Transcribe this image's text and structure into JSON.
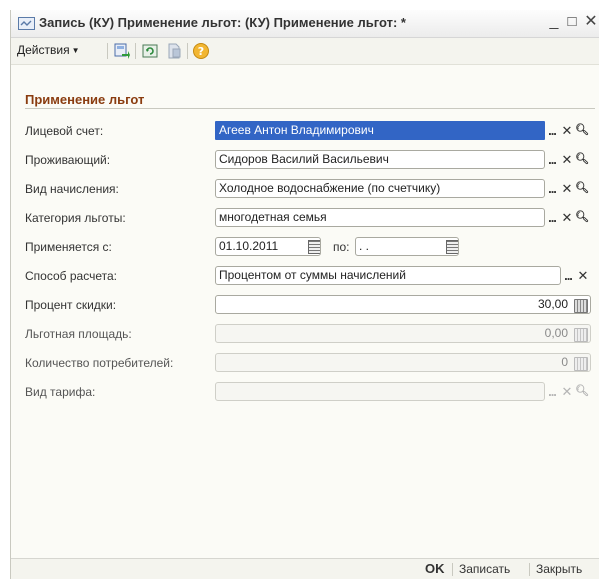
{
  "window": {
    "title": "Запись (КУ) Применение льгот: (КУ) Применение льгот: *",
    "minimize": "_",
    "maximize": "□",
    "close": "✕"
  },
  "toolbar": {
    "actions_label": "Действия",
    "icons": [
      "save-close-icon",
      "refresh-icon",
      "document-icon",
      "help-icon"
    ]
  },
  "section": {
    "title": "Применение льгот"
  },
  "form": {
    "account": {
      "label": "Лицевой счет:",
      "value": "Агеев Антон Владимирович"
    },
    "resident": {
      "label": "Проживающий:",
      "value": "Сидоров Василий Васильевич"
    },
    "charge_type": {
      "label": "Вид начисления:",
      "value": "Холодное водоснабжение  (по счетчику)"
    },
    "benefit_category": {
      "label": "Категория льготы:",
      "value": "многодетная семья"
    },
    "applies_from": {
      "label": "Применяется с:",
      "value": "01.10.2011",
      "to_label": "по:",
      "to_value": " .  ."
    },
    "calc_method": {
      "label": "Способ расчета:",
      "value": "Процентом от суммы начислений"
    },
    "discount_percent": {
      "label": "Процент скидки:",
      "value": "30,00"
    },
    "benefit_area": {
      "label": "Льготная площадь:",
      "value": "0,00"
    },
    "consumers_count": {
      "label": "Количество потребителей:",
      "value": "0"
    },
    "tariff_type": {
      "label": "Вид тарифа:",
      "value": ""
    }
  },
  "footer": {
    "ok": "OK",
    "save": "Записать",
    "close": "Закрыть"
  },
  "colors": {
    "section_title": "#8a3c10",
    "selection": "#3265c5"
  }
}
